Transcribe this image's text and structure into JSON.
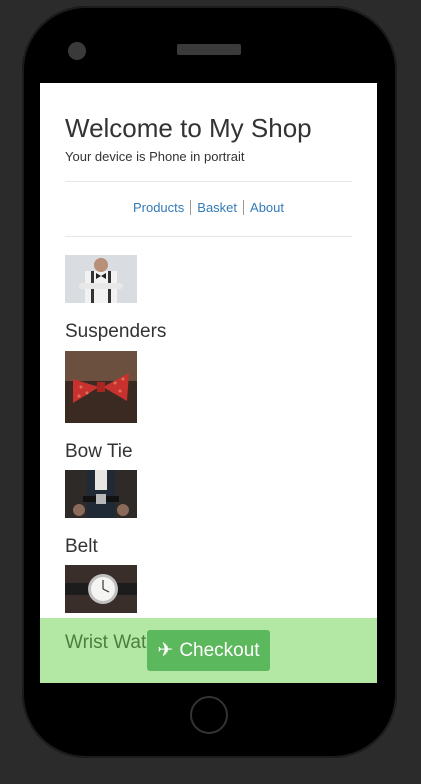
{
  "page": {
    "title": "Welcome to My Shop",
    "subtitle": "Your device is Phone in portrait"
  },
  "nav": {
    "items": [
      {
        "label": "Products"
      },
      {
        "label": "Basket"
      },
      {
        "label": "About"
      }
    ]
  },
  "products": [
    {
      "name": "Suspenders"
    },
    {
      "name": "Bow Tie"
    },
    {
      "name": "Belt"
    },
    {
      "name": "Wrist Wat"
    }
  ],
  "checkout": {
    "icon": "airplane-icon",
    "icon_glyph": "✈",
    "label": "Checkout"
  },
  "colors": {
    "link": "#337ab7",
    "checkout_bar": "#b2e8a3",
    "checkout_button": "#5cb85c"
  }
}
